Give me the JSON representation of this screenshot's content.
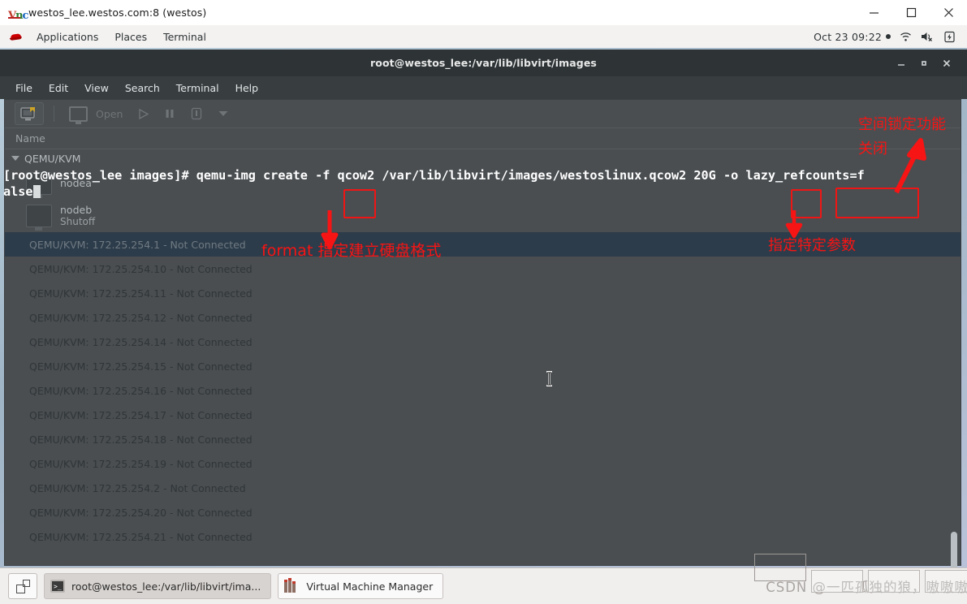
{
  "viewer": {
    "icon": "vnc-viewer-icon",
    "title": "westos_lee.westos.com:8 (westos)",
    "buttons": {
      "minimize": "minimize-icon",
      "maximize": "maximize-icon",
      "close": "close-icon"
    }
  },
  "gnome_panel": {
    "logo": "redhat-logo",
    "menus": [
      "Applications",
      "Places",
      "Terminal"
    ],
    "clock": "Oct 23  09:22",
    "tray": [
      "wifi-icon",
      "volume-muted-icon",
      "battery-charging-icon"
    ]
  },
  "terminal": {
    "title": "root@westos_lee:/var/lib/libvirt/images",
    "menus": [
      "File",
      "Edit",
      "View",
      "Search",
      "Terminal",
      "Help"
    ],
    "buttons": {
      "minimize": "minimize-icon",
      "maximize": "maximize-icon",
      "close": "close-icon"
    },
    "prompt": "[root@westos_lee images]# ",
    "command_part1": "qemu-img create ",
    "command_flag_f": "-f",
    "command_part2": " qcow2 /var/lib/libvirt/images/westoslinux.qcow2 20G ",
    "command_flag_o": "-o",
    "command_part3": " ",
    "command_option": "lazy_refcounts=f",
    "command_wrap": "alse"
  },
  "vmm": {
    "toolbar": {
      "new_vm": "new-vm-icon",
      "open_label": "Open",
      "open_icon": "monitor-icon",
      "run_icon": "play-icon",
      "pause_icon": "pause-icon",
      "shutdown_icon": "shutdown-icon",
      "menu_icon": "chevron-down-icon"
    },
    "column_header": "Name",
    "group": "QEMU/KVM",
    "children": [
      {
        "name": "nodea",
        "state": ""
      },
      {
        "name": "nodeb",
        "state": "Shutoff"
      }
    ],
    "rows": [
      "QEMU/KVM: 172.25.254.1 - Not Connected",
      "QEMU/KVM: 172.25.254.10 - Not Connected",
      "QEMU/KVM: 172.25.254.11 - Not Connected",
      "QEMU/KVM: 172.25.254.12 - Not Connected",
      "QEMU/KVM: 172.25.254.14 - Not Connected",
      "QEMU/KVM: 172.25.254.15 - Not Connected",
      "QEMU/KVM: 172.25.254.16 - Not Connected",
      "QEMU/KVM: 172.25.254.17 - Not Connected",
      "QEMU/KVM: 172.25.254.18 - Not Connected",
      "QEMU/KVM: 172.25.254.19 - Not Connected",
      "QEMU/KVM: 172.25.254.2 - Not Connected",
      "QEMU/KVM: 172.25.254.20 - Not Connected",
      "QEMU/KVM: 172.25.254.21 - Not Connected"
    ],
    "selected_index": 0
  },
  "annotations": {
    "color": "#f71414",
    "format_note": "format 指定建立硬盘格式",
    "param_note": "指定特定参数",
    "lock_note_line1": "空间锁定功能",
    "lock_note_line2": "关闭"
  },
  "taskbar": {
    "show_desktop": "show-desktop-icon",
    "items": [
      {
        "label": "root@westos_lee:/var/lib/libvirt/ima...",
        "icon": "terminal-icon",
        "active": true
      },
      {
        "label": "Virtual Machine Manager",
        "icon": "vmm-icon",
        "active": false
      }
    ],
    "watermark": "CSDN @一匹孤独的狼，嗷嗷嗷"
  }
}
